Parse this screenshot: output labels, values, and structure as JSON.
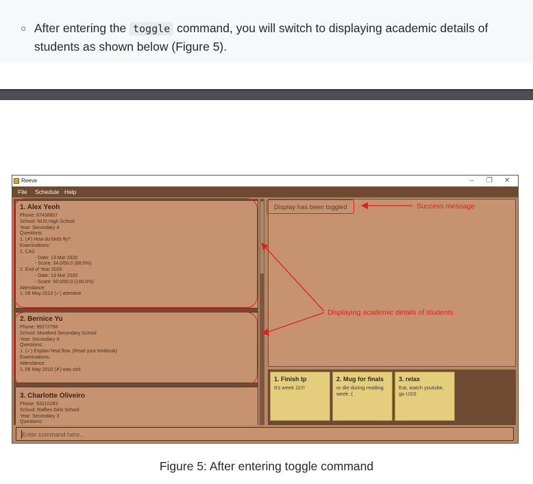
{
  "doc": {
    "bullet_text_before": "After entering the ",
    "code": "toggle",
    "bullet_text_after": " command, you will switch to displaying academic details of students as shown below (Figure 5).",
    "caption": "Figure 5: After entering toggle command"
  },
  "window": {
    "title": "Reeve",
    "controls": {
      "minimize": "–",
      "restore": "❐",
      "close": "✕"
    },
    "menu": [
      "File",
      "Schedule",
      "Help"
    ]
  },
  "students": [
    {
      "name": "1.  Alex Yeoh",
      "lines": [
        "Phone: 87438807",
        "School: NUS High School",
        "Year: Secondary 4",
        "Questions:",
        "1. (✗) How do birds fly?",
        "Examinations:",
        "1. CA2"
      ],
      "indented_a": [
        "- Date: 13 Mar 2020",
        "- Score: 34.0/50.0 (68.0%)"
      ],
      "mid": [
        "2. End of Year 2020"
      ],
      "indented_b": [
        "- Date: 13 Mar 2020",
        "- Score: 50.0/50.0 (100.0%)"
      ],
      "tail": [
        "Attendance:",
        "1. 06 May 2010 (✓) attentive"
      ]
    },
    {
      "name": "2.  Bernice Yu",
      "lines": [
        "Phone: 99272758",
        "School: Montford Secondary School",
        "Year: Secondary 4",
        "Questions:",
        "1. (✓) Explain heat flow. (Read your textbook)",
        "Examinations:",
        "Attendance:",
        "1. 06 May 2010 (✗) was sick"
      ]
    },
    {
      "name": "3.  Charlotte Oliveiro",
      "lines": [
        "Phone: 93210283",
        "School: Raffles Girls School",
        "Year: Secondary 3",
        "Questions:"
      ]
    }
  ],
  "result_display": {
    "message": "Display has been toggled"
  },
  "notes": [
    {
      "title": "1. Finish tp",
      "body": "It's week 11!!!"
    },
    {
      "title": "2. Mug for finals",
      "body": "or die during reading week :("
    },
    {
      "title": "3. relax",
      "body": "Eat, watch youtube, go USS"
    }
  ],
  "command_box": {
    "placeholder": "Enter command here..."
  },
  "annotations": {
    "success_label": "Success message",
    "academic_label": "Displaying academic details of students",
    "color": "#e0201f"
  }
}
